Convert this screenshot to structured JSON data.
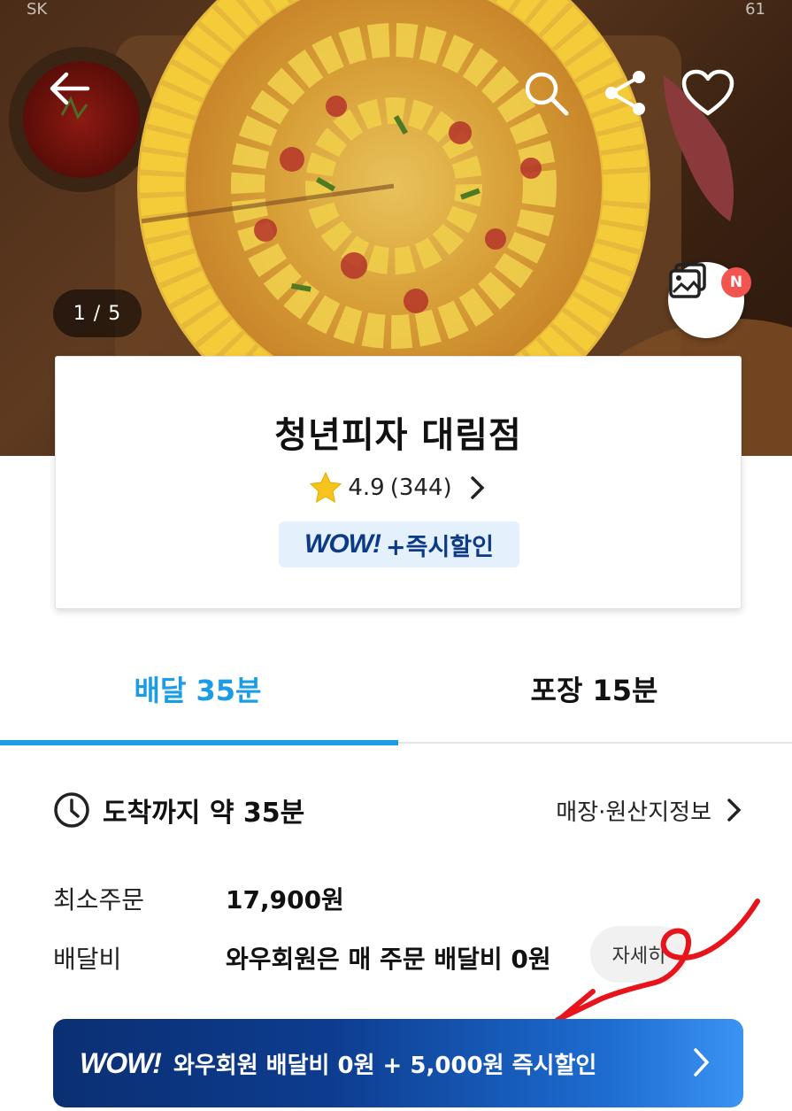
{
  "status_bar": {
    "carrier": "SK",
    "battery": "61"
  },
  "hero": {
    "pager_text": "1 / 5",
    "gallery_badge": "N"
  },
  "store": {
    "name": "청년피자 대림점",
    "rating": "4.9",
    "review_count": "(344)",
    "wow_logo": "WOW!",
    "wow_discount": "+즉시할인"
  },
  "tabs": [
    {
      "label": "배달 35분",
      "active": true
    },
    {
      "label": "포장 15분",
      "active": false
    }
  ],
  "eta": {
    "text": "도착까지 약 35분",
    "store_info_link": "매장·원산지정보"
  },
  "min_order": {
    "label": "최소주문",
    "value": "17,900원"
  },
  "delivery_fee": {
    "label": "배달비",
    "value": "와우회원은 매 주문 배달비 0원",
    "detail_button": "자세히"
  },
  "banner": {
    "wow_logo": "WOW!",
    "text": "와우회원 배달비 0원 + 5,000원 즉시할인"
  },
  "colors": {
    "accent": "#1a9de6",
    "wow_navy": "#0c3a86",
    "annotation_red": "#e8141c",
    "badge_red": "#f2544f"
  },
  "icons": [
    "back-arrow-icon",
    "search-icon",
    "share-icon",
    "heart-icon",
    "gallery-icon",
    "star-icon",
    "chevron-right-icon",
    "clock-icon"
  ]
}
